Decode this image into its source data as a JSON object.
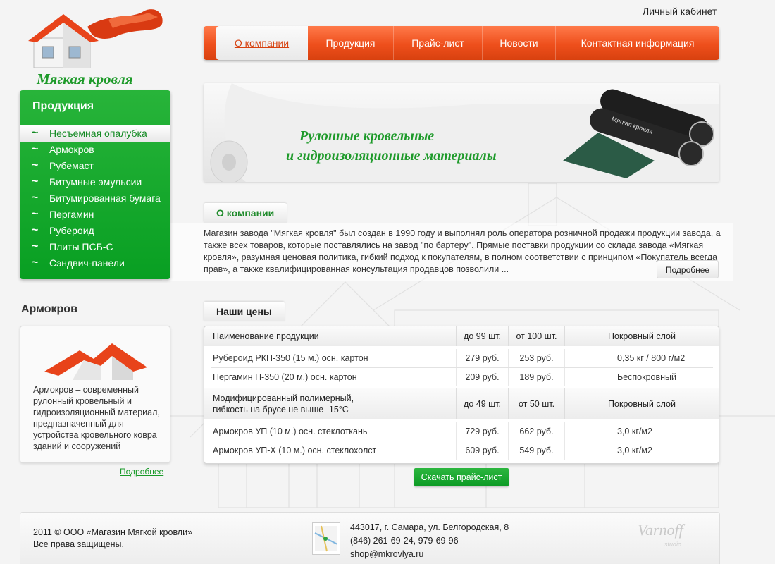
{
  "logo": {
    "text": "Мягкая кровля"
  },
  "header": {
    "cabinet_link": "Личный кабинет"
  },
  "nav": {
    "items": [
      {
        "label": "О компании"
      },
      {
        "label": "Продукция"
      },
      {
        "label": "Прайс-лист"
      },
      {
        "label": "Новости"
      },
      {
        "label": "Контактная информация"
      }
    ]
  },
  "sidebar": {
    "title": "Продукция",
    "items": [
      {
        "label": "Несъемная опалубка"
      },
      {
        "label": "Армокров"
      },
      {
        "label": "Рубемаст"
      },
      {
        "label": "Битумные эмульсии"
      },
      {
        "label": "Битумированная бумага"
      },
      {
        "label": "Пергамин"
      },
      {
        "label": "Рубероид"
      },
      {
        "label": "Плиты ПСБ-С"
      },
      {
        "label": "Сэндвич-панели"
      }
    ]
  },
  "product_card": {
    "title": "Армокров",
    "description": "Армокров – современный рулонный кровельный и гидроизоляционный материал, предназначенный для устройства кровельного ковра зданий и сооружений",
    "more_link": "Подробнее"
  },
  "banner": {
    "line1": "Рулонные кровельные",
    "line2": "и гидроизоляционные материалы",
    "roll_label": "Мягкая кровля"
  },
  "about": {
    "title": "О компании",
    "text": "Магазин завода \"Мягкая кровля\" был создан в 1990 году и выполнял роль оператора розничной продажи продукции завода, а также всех товаров, которые поставлялись на завод \"по бартеру\". Прямые поставки продукции со склада завода «Мягкая кровля», разумная ценовая политика, гибкий подход к покупателям, в полном соответствии с принципом «Покупатель всегда прав», а также квалифицированная консультация продавцов позволили ...",
    "more_button": "Подробнее"
  },
  "prices": {
    "title": "Наши цены",
    "group1": {
      "headers": [
        "Наименование продукции",
        "до 99 шт.",
        "от 100 шт.",
        "Покровный слой"
      ],
      "rows": [
        [
          "Рубероид РКП-350 (15 м.) осн. картон",
          "279 руб.",
          "253 руб.",
          "0,35 кг / 800 г/м2"
        ],
        [
          "Пергамин П-350  (20 м.) осн. картон",
          "209 руб.",
          "189 руб.",
          "Беспокровный"
        ]
      ]
    },
    "group2": {
      "headers_line1": "Модифицированный полимерный,",
      "headers_line2": "гибкость на брусе не выше -15°С",
      "headers": [
        "до 49 шт.",
        "от 50 шт.",
        "Покровный слой"
      ],
      "rows": [
        [
          "Армокров УП (10 м.) осн. стеклоткань",
          "729 руб.",
          "662 руб.",
          "3,0 кг/м2"
        ],
        [
          "Армокров УП-Х (10 м.) осн. стеклохолст",
          "609 руб.",
          "549 руб.",
          "3,0 кг/м2"
        ]
      ]
    },
    "download_button": "Скачать прайс-лист"
  },
  "footer": {
    "copyright_line1": "2011 © ООО «Магазин Мягкой кровли»",
    "copyright_line2": "Все права защищены.",
    "address": "443017, г. Самара, ул. Белгородская, 8",
    "phone": "(846) 261-69-24, 979-69-96",
    "email": "shop@mkrovlya.ru",
    "studio": "Varnoff",
    "studio_sub": "studio"
  },
  "colors": {
    "green": "#1e9a2a",
    "orange": "#ee4f1c"
  }
}
